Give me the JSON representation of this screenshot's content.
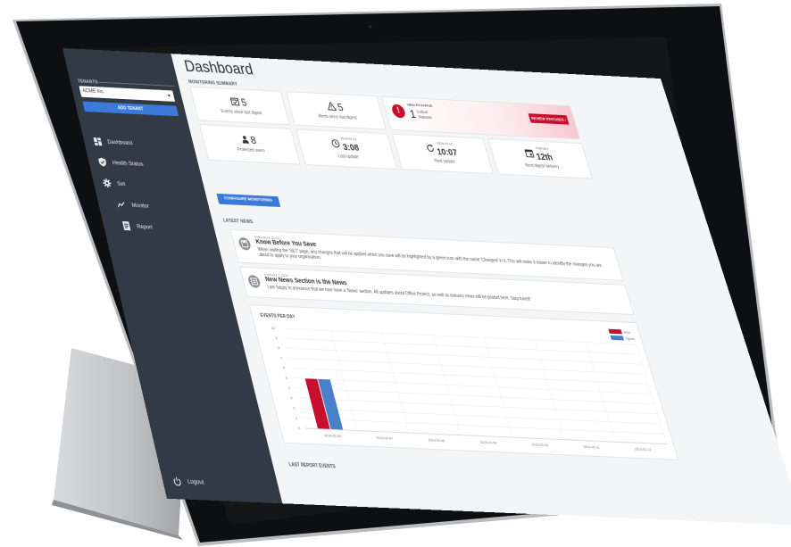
{
  "sidebar": {
    "tenants_label": "TENANTS",
    "tenant_value": "ACME Inc",
    "add_tenant_label": "ADD TENANT",
    "items": [
      {
        "label": "Dashboard",
        "icon": "dashboard-icon"
      },
      {
        "label": "Health Status",
        "icon": "shield-icon"
      },
      {
        "label": "Set",
        "icon": "gear-icon"
      },
      {
        "label": "Monitor",
        "icon": "trend-line-icon"
      },
      {
        "label": "Report",
        "icon": "document-icon"
      }
    ],
    "logout_label": "Logout"
  },
  "main": {
    "title": "Dashboard",
    "monitoring_summary_label": "MONITORING SUMMARY",
    "cards": {
      "events": {
        "value": "5",
        "caption": "Events since last digest"
      },
      "alerts": {
        "value": "5",
        "caption": "Alerts since last digest"
      },
      "health": {
        "label": "HEALTH STATUS",
        "value": "1",
        "caption_line1": "Critical",
        "caption_line2": "Statuses",
        "button": "REVIEW STATUSES"
      },
      "protected": {
        "value": "8",
        "caption": "Protected users"
      },
      "last_update": {
        "date": "2019-02-12",
        "value": "3:08",
        "caption": "Last update"
      },
      "next_update": {
        "date": "2019-02-12",
        "value": "10:07",
        "caption": "Next update"
      },
      "next_digest": {
        "date": "February",
        "value": "12th",
        "caption": "Next digest delivery"
      }
    },
    "configure_button": "CONFIGURE MONITORING",
    "latest_news_label": "LATEST NEWS",
    "news": [
      {
        "date": "February 8, 2019",
        "title": "Know Before You Save",
        "body": "When visiting the 'SET' page, any changes that will be applied when you save will be highlighted by a green icon with the name 'Changed' in it. This will make it easier to identify the changes you are about to apply to your organisation."
      },
      {
        "date": "February 7, 2019",
        "title": "New News Section is the News",
        "body": "I am happy to announce that we now have a 'News' section. All updates about Office Protect, as well as industry news will be posted here. Stay tuned!"
      }
    ],
    "last_report_label": "LAST REPORT EVENTS"
  },
  "colors": {
    "sidebar_bg": "#323b45",
    "accent_blue": "#3b7ad9",
    "critical_red": "#c8102e"
  },
  "chart_data": {
    "type": "bar",
    "title": "EVENTS PER DAY",
    "categories": [
      "2019-02-06",
      "2019-02-07",
      "2019-02-08",
      "2019-02-09",
      "2019-02-10",
      "2019-02-11",
      "2019-02-12"
    ],
    "series": [
      {
        "name": "Alerts",
        "color": "#c8102e",
        "values": [
          5,
          0,
          0,
          0,
          0,
          0,
          0
        ]
      },
      {
        "name": "Digests",
        "color": "#4a7fc9",
        "values": [
          5,
          0,
          0,
          0,
          0,
          0,
          0
        ]
      }
    ],
    "yticks": [
      "0",
      "1",
      "2",
      "3",
      "4",
      "5",
      "6",
      "7",
      "8",
      "9",
      "10"
    ],
    "ylim": [
      0,
      10
    ],
    "grid": true,
    "legend": "top-right"
  }
}
